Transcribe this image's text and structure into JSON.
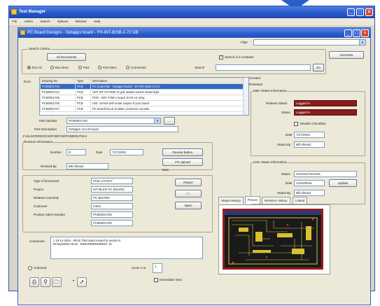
{
  "outer_window": {
    "title": "Test Manager",
    "menu": [
      "File",
      "Admin",
      "Search",
      "Options",
      "Window",
      "Help"
    ]
  },
  "inner_window": {
    "title": "PC Board Designs - Getapps board - FH-INT-B/SB-1-72 DB",
    "filter_label": "Filter",
    "filter_value": "",
    "overview_label": "Overview"
  },
  "search": {
    "group_label": "Search Criteria",
    "all_docs_button": "All Documents",
    "contains_label": "Search is a Contains",
    "contains_checked": true,
    "options": [
      {
        "label": "Doc ID",
        "selected": true
      },
      {
        "label": "Box Desc",
        "selected": false
      },
      {
        "label": "Part",
        "selected": false
      },
      {
        "label": "Part Desc",
        "selected": false
      },
      {
        "label": "Comments",
        "selected": false
      }
    ],
    "search_for_label": "Search",
    "search_for_value": "",
    "go_button": "Go"
  },
  "document_list": {
    "label": "Docs",
    "columns": [
      "Drawing No",
      "Type",
      "Description"
    ],
    "rows": [
      {
        "cells": [
          "PCB0001703",
          "PCB",
          "PC board kits - Getapps board - 10 Ruh Blast 14 Co"
        ],
        "selected": true
      },
      {
        "cells": [
          "PCB0001704",
          "PCB",
          "ANT INT FH-SRB 14 gde station w/LED status light"
        ],
        "selected": false
      },
      {
        "cells": [
          "PCB0001705",
          "PCB",
          "PCB - GET F/SB-1 board 10-01 v4 relay"
        ],
        "selected": false
      },
      {
        "cells": [
          "PCB0001706",
          "PCB",
          "Unit: control with smart output of your board"
        ],
        "selected": false
      },
      {
        "cells": [
          "PCB0001707",
          "PCB",
          "PC board/circuit 10 plate connector 1st plan"
        ],
        "selected": false
      }
    ]
  },
  "part": {
    "part_number_label": "Part Number",
    "part_number_value": "PCB0001703",
    "part_desc_label": "Part Description",
    "part_desc_value": "Getapps circuit board",
    "path_text": "J:\\A\\LINTER\\DOCS\\PCB\\PCB\\PCB0001703.6"
  },
  "revision": {
    "group_label": "Revision Information",
    "number_label": "Number",
    "number_value": "D",
    "date_label": "Date",
    "date_value": "7/17/2004",
    "revised_by_label": "Revised By",
    "revised_by_value": "Bill Allread",
    "review_button": "Review Button",
    "file_button": "FR Upload",
    "new_label": "New"
  },
  "details": {
    "rows": [
      {
        "label": "Type of Document",
        "value": "PCB LAYOUT"
      },
      {
        "label": "Project",
        "value": "KIT-BLKD PC BOARD"
      },
      {
        "label": "Related Assembly",
        "value": "PC BOARD"
      },
      {
        "label": "Customer",
        "value": "Intest"
      },
      {
        "label": "Product Sales Number",
        "value": "PCB0001703"
      },
      {
        "label": "",
        "value": "PCB0001703"
      }
    ],
    "report_button": "Report",
    "cd_button": "CD",
    "open_button": "Open"
  },
  "comments": {
    "label": "Comments",
    "lines": [
      "1 10-12-2004 - 09:52 This board moved to section 6",
      "BASQUEEN 09:26 - ENBARRIERE/BEST 15"
    ]
  },
  "status": {
    "created_label": "Created",
    "released_label": "Released",
    "main_group_label": "Main Status Information",
    "release_status_label": "Release Status",
    "release_status_value": "Logged In",
    "status_label": "Status",
    "status_value": "Logged In",
    "disable_checkbox_label": "Disable Checklists",
    "date_label": "Date",
    "date_value": "7/17/2004",
    "status_by_label": "Status By",
    "status_by_value": "Bill Allread"
  },
  "user_status": {
    "group_label": "User Status Information",
    "status_label": "Status",
    "status_value": "Checked Remark",
    "date_label": "Date",
    "date_value": "1/16/2004a",
    "update_button": "Update",
    "status_by_label": "Status By",
    "status_by_value": "Bill Allread"
  },
  "tabs": [
    {
      "label": "Status History",
      "active": false
    },
    {
      "label": "Picture",
      "active": true
    },
    {
      "label": "Revision History",
      "active": false
    },
    {
      "label": "Linked",
      "active": false
    }
  ],
  "footer": {
    "unbound_label": "Unbound",
    "zoom_label": "Zoom  1 to",
    "zoom_value": "1",
    "immediate_view_label": "Immediate View"
  },
  "colors": {
    "title_blue": "#2456c9",
    "status_red": "#8a1c1c",
    "pcb_trace": "#c8c840"
  },
  "icons": [
    "print-icon",
    "print-preview-icon",
    "open-folder-icon",
    "export-icon",
    "lock-icon"
  ]
}
